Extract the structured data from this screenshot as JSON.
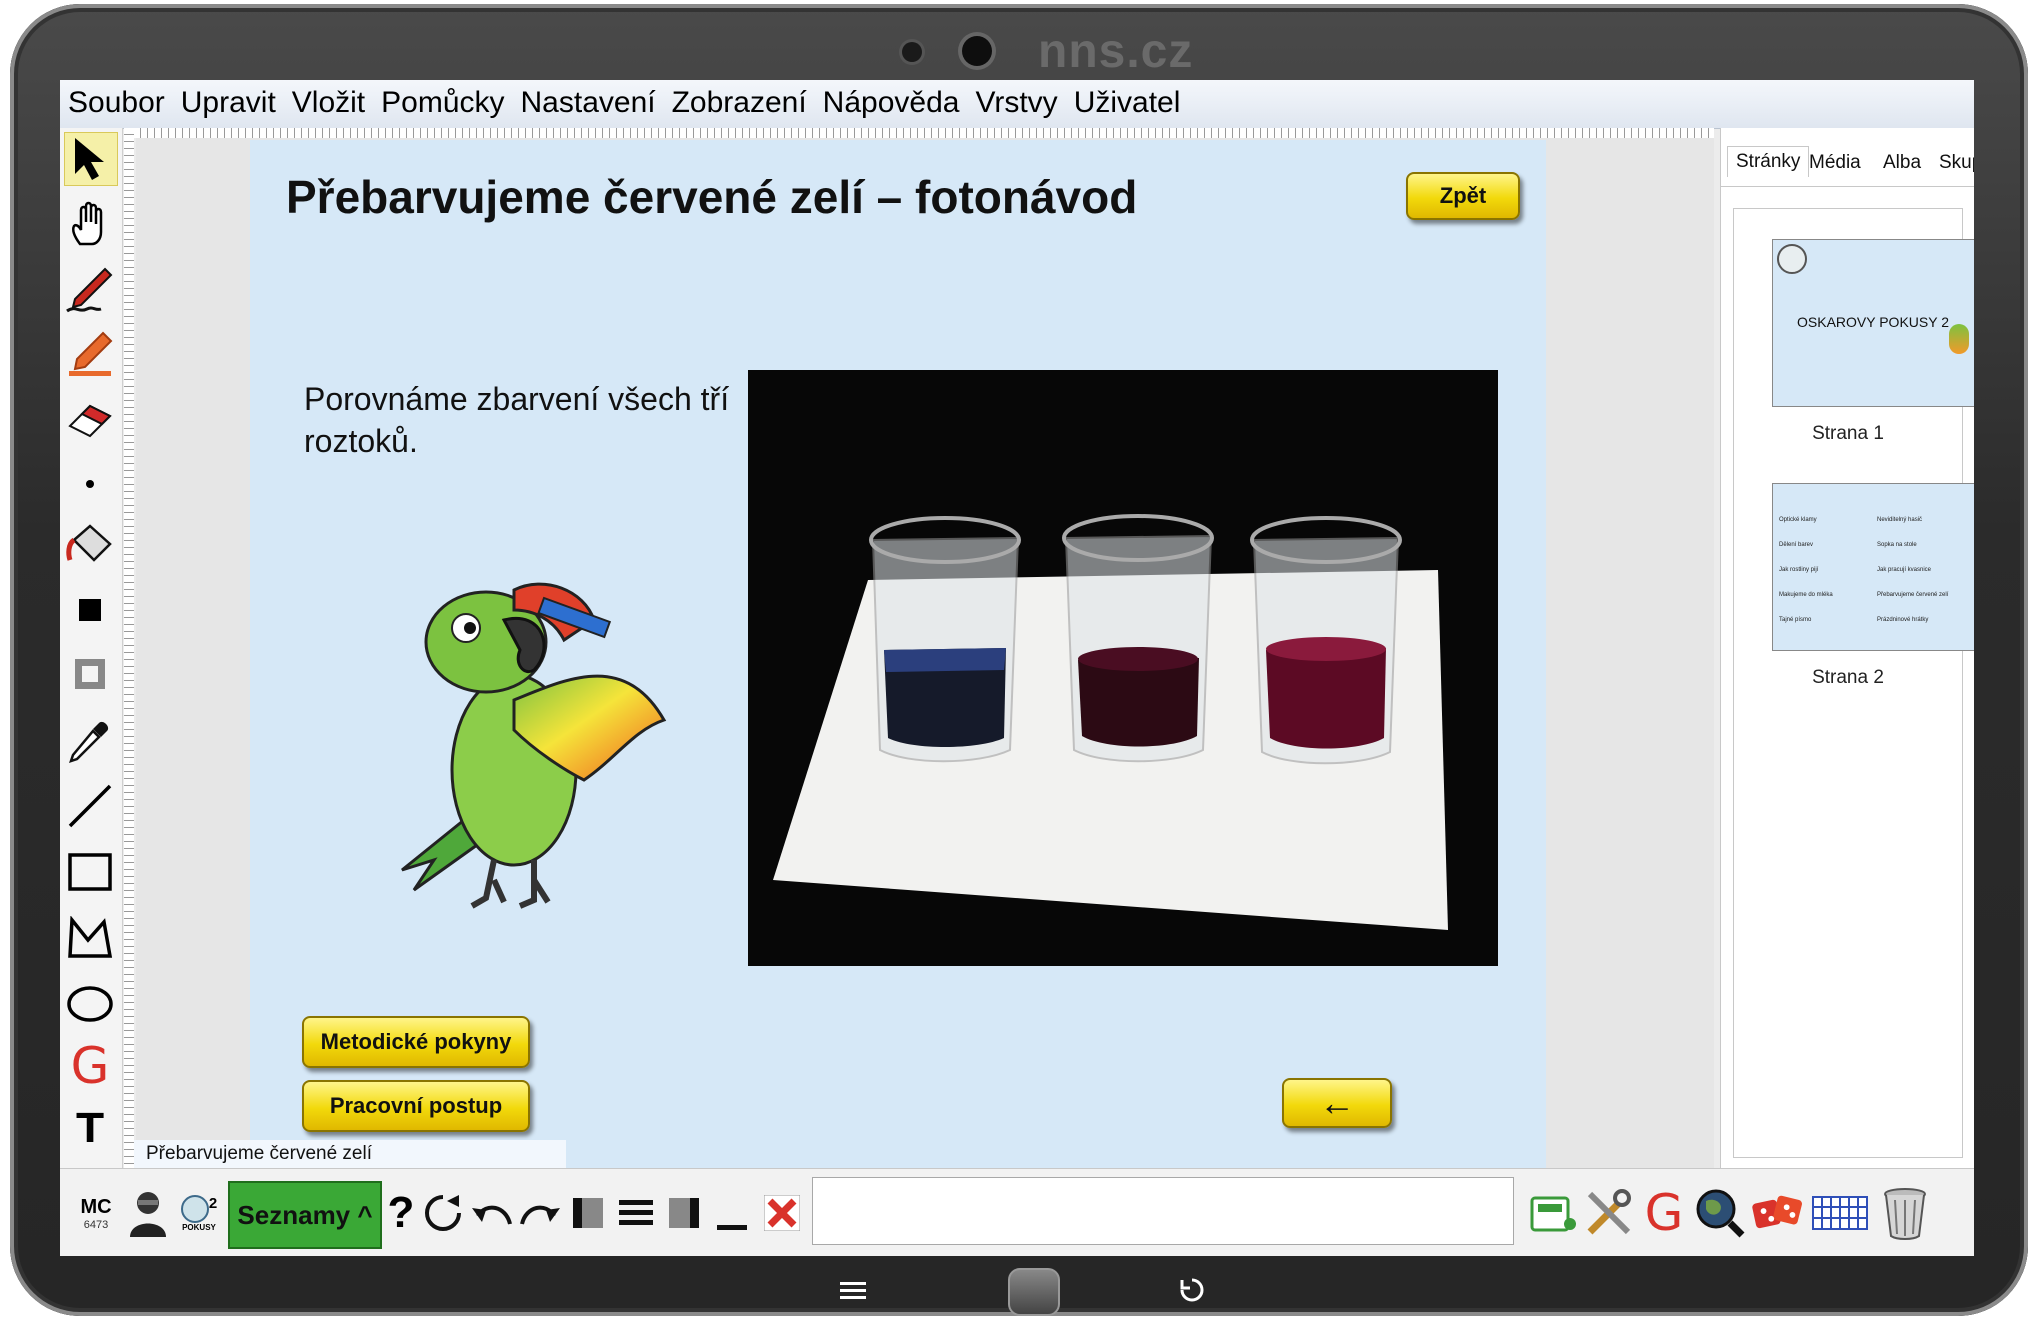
{
  "device": {
    "brand": "nns.cz"
  },
  "menu": [
    "Soubor",
    "Upravit",
    "Vložit",
    "Pomůcky",
    "Nastavení",
    "Zobrazení",
    "Nápověda",
    "Vrstvy",
    "Uživatel"
  ],
  "tools": [
    {
      "name": "select-arrow-tool",
      "icon": "arrow-cursor-icon"
    },
    {
      "name": "hand-tool",
      "icon": "hand-icon"
    },
    {
      "name": "pen-tool",
      "icon": "pen-icon"
    },
    {
      "name": "highlighter-tool",
      "icon": "highlighter-icon"
    },
    {
      "name": "eraser-tool",
      "icon": "eraser-icon"
    },
    {
      "name": "dot-tool",
      "icon": "dot-icon"
    },
    {
      "name": "fill-tool",
      "icon": "paint-bucket-icon"
    },
    {
      "name": "fill-color-tool",
      "icon": "black-square-icon"
    },
    {
      "name": "line-color-tool",
      "icon": "gray-square-icon"
    },
    {
      "name": "eyedropper-tool",
      "icon": "eyedropper-icon"
    },
    {
      "name": "line-tool",
      "icon": "line-icon"
    },
    {
      "name": "rectangle-tool",
      "icon": "rectangle-icon"
    },
    {
      "name": "polygon-tool",
      "icon": "polygon-icon"
    },
    {
      "name": "ellipse-tool",
      "icon": "ellipse-icon"
    },
    {
      "name": "geogebra-tool",
      "icon": "g-letter-icon"
    },
    {
      "name": "text-tool",
      "icon": "t-letter-icon"
    }
  ],
  "slide": {
    "title": "Přebarvujeme červené zelí – fotonávod",
    "back_button": "Zpět",
    "description": "Porovnáme zbarvení všech tří roztoků.",
    "buttons": {
      "methodical": "Metodické pokyny",
      "procedure": "Pracovní postup"
    },
    "prev_arrow": "←",
    "footer_label": "Přebarvujeme červené zelí"
  },
  "panel": {
    "tabs": [
      "Stránky",
      "Média",
      "Alba",
      "Skupiny"
    ],
    "active_tab": "Stránky",
    "pages": [
      {
        "label": "Strana 1",
        "thumb_title": "OSKAROVY POKUSY 2"
      },
      {
        "label": "Strana 2",
        "items_left": [
          "Optické klamy",
          "Dělení barev",
          "Jak rostliny pijí",
          "Makujeme do mléka",
          "Tajné písmo"
        ],
        "items_right": [
          "Neviditelný hasič",
          "Sopka na stole",
          "Jak pracují kvasnice",
          "Přebarvujeme červené zelí",
          "Prázdninové hrátky"
        ]
      }
    ]
  },
  "bottom": {
    "mc_label": "MC",
    "mc_number": "6473",
    "pokusy_badge": "2",
    "pokusy_label": "POKUSY",
    "seznamy": "Seznamy ^",
    "help": "?",
    "g_letter": "G"
  },
  "colors": {
    "page_bg": "#d6e8f7",
    "button_yellow": "#f2d90b",
    "seznamy_green": "#3aa836",
    "g_red": "#d9322b"
  }
}
